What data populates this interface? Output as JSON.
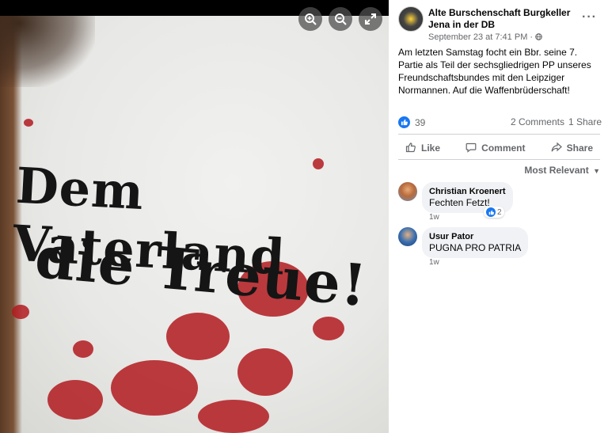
{
  "viewer": {
    "zoom_in_icon": "zoom-in-icon",
    "zoom_out_icon": "zoom-out-icon",
    "fullscreen_icon": "fullscreen-icon",
    "photo_text_line1": "Dem Vaterland",
    "photo_text_line2": "die Treue!"
  },
  "post": {
    "page_name": "Alte Burschenschaft Burgkeller Jena in der DB",
    "timestamp": "September 23 at 7:41 PM",
    "audience_icon": "globe-icon",
    "more": "···",
    "text": "Am letzten Samstag focht ein Bbr. seine 7. Partie als Teil der sechsgliedrigen PP unseres Freundschaftsbundes mit den Leipziger Normannen. Auf die Waffenbrüderschaft!",
    "reaction_count": "39",
    "comments_count": "2 Comments",
    "shares_count": "1 Share"
  },
  "actions": {
    "like": "Like",
    "comment": "Comment",
    "share": "Share"
  },
  "comments_filter": "Most Relevant",
  "comments": [
    {
      "author": "Christian Kroenert",
      "text": "Fechten Fetzt!",
      "time": "1w",
      "reactions": "2"
    },
    {
      "author": "Usur Pator",
      "text": "PUGNA PRO PATRIA",
      "time": "1w"
    }
  ],
  "colors": {
    "accent": "#1877f2",
    "muted": "#65676b",
    "bubble": "#f0f2f5"
  }
}
